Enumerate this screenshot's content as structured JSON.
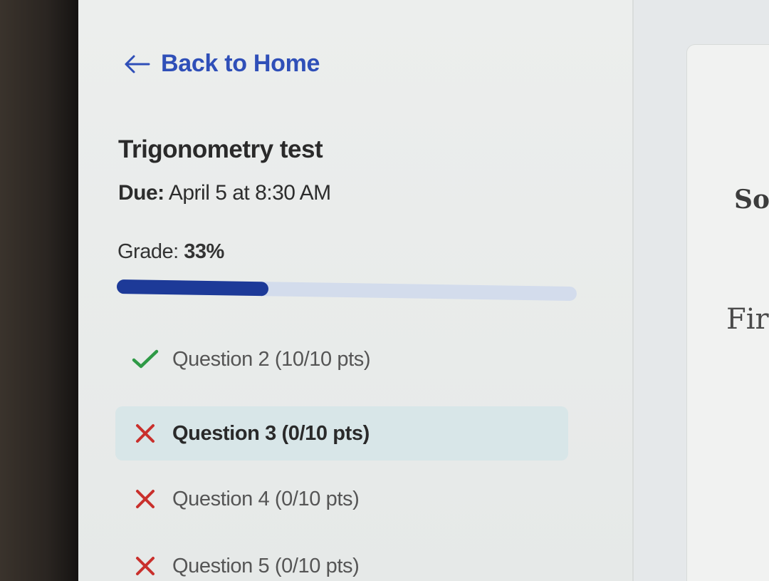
{
  "nav": {
    "back_label": "Back to Home"
  },
  "test": {
    "title": "Trigonometry test",
    "due_label": "Due:",
    "due_value": "April 5 at 8:30 AM",
    "grade_label": "Grade:",
    "grade_value": "33%",
    "grade_fraction": 0.33
  },
  "questions": [
    {
      "label": "Question 2 (10/10 pts)",
      "status": "correct",
      "icon": "check-icon",
      "selected": false
    },
    {
      "label": "Question 3 (0/10 pts)",
      "status": "incorrect",
      "icon": "x-icon",
      "selected": true
    },
    {
      "label": "Question 4 (0/10 pts)",
      "status": "incorrect",
      "icon": "x-icon",
      "selected": false
    },
    {
      "label": "Question 5 (0/10 pts)",
      "status": "incorrect",
      "icon": "x-icon",
      "selected": false
    }
  ],
  "main_panel": {
    "heading_partial": "So",
    "subheading_partial": "Fir"
  },
  "colors": {
    "link": "#2f4fb8",
    "progress_fill": "#1d3a98",
    "progress_track": "#d3dcec",
    "correct": "#2e9a46",
    "incorrect": "#c9302c",
    "selected_row": "#d8e6e8"
  }
}
